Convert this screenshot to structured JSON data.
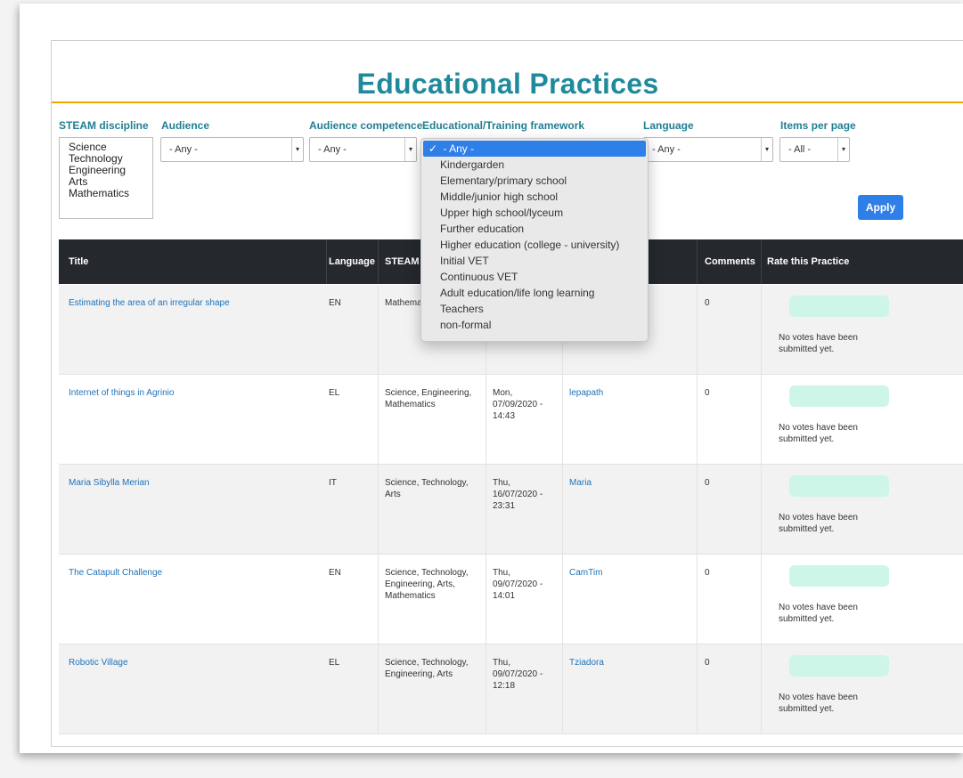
{
  "page": {
    "title": "Educational Practices"
  },
  "filters": {
    "steam_label": "STEAM discipline",
    "steam_options": [
      "Science",
      "Technology",
      "Engineering",
      "Arts",
      "Mathematics"
    ],
    "audience_label": "Audience",
    "audience_value": "- Any -",
    "competence_label": "Audience competence",
    "competence_value": "- Any -",
    "framework_label": "Educational/Training framework",
    "language_label": "Language",
    "language_value": "- Any -",
    "items_label": "Items per page",
    "items_value": "- All -",
    "apply_label": "Apply"
  },
  "framework_dropdown": {
    "selected_mark": "✓",
    "options": [
      "- Any -",
      "Kindergarden",
      "Elementary/primary school",
      "Middle/junior high school",
      "Upper high school/lyceum",
      "Further education",
      "Higher education (college - university)",
      "Initial VET",
      "Continuous VET",
      "Adult education/life long learning",
      "Teachers",
      "non-formal"
    ]
  },
  "table": {
    "headers": {
      "title": "Title",
      "language": "Language",
      "steam": "STEAM d",
      "comments": "Comments",
      "rate": "Rate this Practice"
    },
    "rows": [
      {
        "title": "Estimating the area of an irregular shape",
        "language": "EN",
        "steam": "Mathema",
        "date": "",
        "author": "",
        "comments": "0",
        "rate_text": "No votes have been submitted yet."
      },
      {
        "title": "Internet of things in Agrinio",
        "language": "EL",
        "steam": "Science, Engineering, Mathematics",
        "date": "Mon, 07/09/2020 - 14:43",
        "author": "lepapath",
        "comments": "0",
        "rate_text": "No votes have been submitted yet."
      },
      {
        "title": "Maria Sibylla Merian",
        "language": "IT",
        "steam": "Science, Technology, Arts",
        "date": "Thu, 16/07/2020 - 23:31",
        "author": "Maria",
        "comments": "0",
        "rate_text": "No votes have been submitted yet."
      },
      {
        "title": "The Catapult Challenge",
        "language": "EN",
        "steam": "Science, Technology, Engineering, Arts, Mathematics",
        "date": "Thu, 09/07/2020 - 14:01",
        "author": "CamTim",
        "comments": "0",
        "rate_text": "No votes have been submitted yet."
      },
      {
        "title": "Robotic Village",
        "language": "EL",
        "steam": "Science, Technology, Engineering, Arts",
        "date": "Thu, 09/07/2020 - 12:18",
        "author": "Tziadora",
        "comments": "0",
        "rate_text": "No votes have been submitted yet."
      }
    ]
  },
  "colors": {
    "title": "#1f8a9c",
    "accent_rule": "#f0a500",
    "link": "#1f72b8",
    "apply_button": "#2f7fe8",
    "header_bg": "#25282d",
    "rating_bar": "#cdf5e8"
  }
}
